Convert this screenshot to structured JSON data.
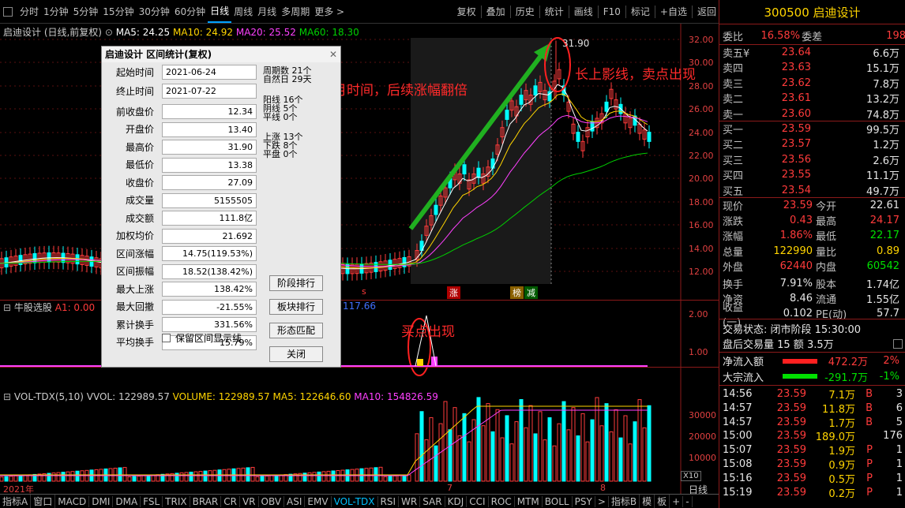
{
  "toolbar": {
    "tabs": [
      "分时",
      "1分钟",
      "5分钟",
      "15分钟",
      "30分钟",
      "60分钟",
      "日线",
      "周线",
      "月线",
      "多周期",
      "更多 >"
    ],
    "active": "日线",
    "tools": [
      "复权",
      "叠加",
      "历史",
      "统计",
      "画线",
      "F10",
      "标记",
      "+自选",
      "返回"
    ]
  },
  "chart": {
    "title": "启迪设计 (日线,前复权)",
    "ma5": "MA5: 24.25",
    "ma10": "MA10: 24.92",
    "ma20": "MA20: 25.52",
    "ma60": "MA60: 18.30",
    "price_ticks": [
      "32.00",
      "30.00",
      "28.00",
      "26.00",
      "24.00",
      "22.00",
      "20.00",
      "18.00",
      "16.00",
      "14.00",
      "12.00"
    ],
    "high_label": "31.90",
    "badges": [
      "涨",
      "榜",
      "减"
    ],
    "s_mark": "s"
  },
  "indicator": {
    "title": "牛股选股",
    "a1": "A1: 0.00",
    "value": "117.66",
    "ticks": [
      "2.00",
      "1.00"
    ]
  },
  "volume": {
    "title": "VOL-TDX(5,10)",
    "vvol": "VVOL: 122989.57",
    "vol": "VOLUME: 122989.57",
    "ma5": "MA5: 122646.60",
    "ma10": "MA10: 154826.59",
    "ticks": [
      "30000",
      "20000",
      "10000"
    ],
    "unit": "X10",
    "period": "日线",
    "axis": [
      "2021年",
      "7",
      "8"
    ]
  },
  "annotations": {
    "a1": "一个月时间，后续涨幅翻倍",
    "a2": "长上影线，卖点出现",
    "a3": "买点出现"
  },
  "dialog": {
    "title": "启迪设计 区间统计(复权)",
    "start_label": "起始时间",
    "start": "2021-06-24",
    "end_label": "终止时间",
    "end": "2021-07-22",
    "rows": [
      [
        "前收盘价",
        "12.34"
      ],
      [
        "开盘价",
        "13.40"
      ],
      [
        "最高价",
        "31.90"
      ],
      [
        "最低价",
        "13.38"
      ],
      [
        "收盘价",
        "27.09"
      ],
      [
        "成交量",
        "5155505"
      ],
      [
        "成交额",
        "111.8亿"
      ],
      [
        "加权均价",
        "21.692"
      ],
      [
        "区间涨幅",
        "14.75(119.53%)"
      ],
      [
        "区间振幅",
        "18.52(138.42%)"
      ],
      [
        "最大上涨",
        "138.42%"
      ],
      [
        "最大回撤",
        "-21.55%"
      ],
      [
        "累计换手",
        "331.56%"
      ],
      [
        "平均换手",
        "15.79%"
      ]
    ],
    "side": [
      "周期数 21个",
      "自然日 29天",
      "阳线 16个",
      "阴线 5个",
      "平线 0个",
      "上涨 13个",
      "下跌 8个",
      "平盘 0个"
    ],
    "buttons": [
      "阶段排行",
      "板块排行",
      "形态匹配",
      "关闭"
    ],
    "checkbox": "保留区间显示线"
  },
  "quote": {
    "code": "300500 启迪设计",
    "weibi_l": "委比",
    "weibi": "16.58%",
    "weicha_l": "委差",
    "weicha": "198",
    "asks": [
      [
        "卖五¥",
        "23.64",
        "6.6万"
      ],
      [
        "卖四",
        "23.63",
        "15.1万"
      ],
      [
        "卖三",
        "23.62",
        "7.8万"
      ],
      [
        "卖二",
        "23.61",
        "13.2万"
      ],
      [
        "卖一",
        "23.60",
        "74.8万"
      ]
    ],
    "bids": [
      [
        "买一",
        "23.59",
        "99.5万"
      ],
      [
        "买二",
        "23.57",
        "1.2万"
      ],
      [
        "买三",
        "23.56",
        "2.6万"
      ],
      [
        "买四",
        "23.55",
        "11.1万"
      ],
      [
        "买五",
        "23.54",
        "49.7万"
      ]
    ],
    "stats": [
      [
        "现价",
        "23.59",
        "今开",
        "22.61"
      ],
      [
        "涨跌",
        "0.43",
        "最高",
        "24.17"
      ],
      [
        "涨幅",
        "1.86%",
        "最低",
        "22.17"
      ],
      [
        "总量",
        "122990",
        "量比",
        "0.89"
      ],
      [
        "外盘",
        "62440",
        "内盘",
        "60542"
      ],
      [
        "换手",
        "7.91%",
        "股本",
        "1.74亿"
      ],
      [
        "净资",
        "8.46",
        "流通",
        "1.55亿"
      ],
      [
        "收益(一)",
        "0.102",
        "PE(动)",
        "57.7"
      ]
    ],
    "status": "交易状态: 闭市阶段 15:30:00",
    "after": "盘后交易量 15 额 3.5万",
    "flow": [
      [
        "净流入额",
        "472.2万",
        "2%"
      ],
      [
        "大宗流入",
        "-291.7万",
        "-1%"
      ]
    ],
    "ticks": [
      [
        "14:56",
        "23.59",
        "7.1万",
        "B",
        "3"
      ],
      [
        "14:57",
        "23.59",
        "11.8万",
        "B",
        "6"
      ],
      [
        "14:57",
        "23.59",
        "1.7万",
        "B",
        "5"
      ],
      [
        "15:00",
        "23.59",
        "189.0万",
        "",
        "176"
      ],
      [
        "15:07",
        "23.59",
        "1.9万",
        "P",
        "1"
      ],
      [
        "15:08",
        "23.59",
        "0.9万",
        "P",
        "1"
      ],
      [
        "15:16",
        "23.59",
        "0.5万",
        "P",
        "1"
      ],
      [
        "15:19",
        "23.59",
        "0.2万",
        "P",
        "1"
      ]
    ]
  },
  "bottom": {
    "tabs": [
      "指标A",
      "窗口",
      "MACD",
      "DMI",
      "DMA",
      "FSL",
      "TRIX",
      "BRAR",
      "CR",
      "VR",
      "OBV",
      "ASI",
      "EMV",
      "VOL-TDX",
      "RSI",
      "WR",
      "SAR",
      "KDJ",
      "CCI",
      "ROC",
      "MTM",
      "BOLL",
      "PSY",
      ">",
      "指标B",
      "模",
      "板",
      "+",
      "-"
    ],
    "active": "VOL-TDX"
  },
  "colors": {
    "up": "#ff3b3b",
    "down": "#00ffff",
    "ma5": "#ffffff",
    "ma10": "#ffd400",
    "ma20": "#ff40ff",
    "ma60": "#00d000"
  }
}
